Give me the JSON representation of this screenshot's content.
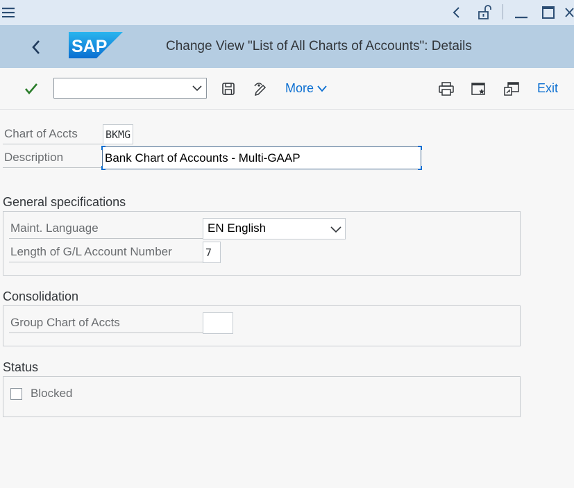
{
  "header": {
    "title": "Change View \"List of All Charts of Accounts\": Details",
    "logo_text": "SAP"
  },
  "toolbar": {
    "command_value": "",
    "more_label": "More",
    "exit_label": "Exit"
  },
  "fields": {
    "chart_of_accts": {
      "label": "Chart of Accts",
      "value": "BKMG"
    },
    "description": {
      "label": "Description",
      "value": "Bank Chart of Accounts - Multi-GAAP"
    }
  },
  "general_specifications": {
    "title": "General specifications",
    "maint_language": {
      "label": "Maint. Language",
      "value": "EN English"
    },
    "gl_length": {
      "label": "Length of G/L Account Number",
      "value": "7"
    }
  },
  "consolidation": {
    "title": "Consolidation",
    "group_chart": {
      "label": "Group Chart of Accts",
      "value": ""
    }
  },
  "status": {
    "title": "Status",
    "blocked": {
      "label": "Blocked",
      "checked": false
    }
  },
  "colors": {
    "sysbar_bg": "#dfe9f4",
    "header_bg": "#b5cde2",
    "accent": "#0a6ed1",
    "check_green": "#2b7d2b"
  }
}
